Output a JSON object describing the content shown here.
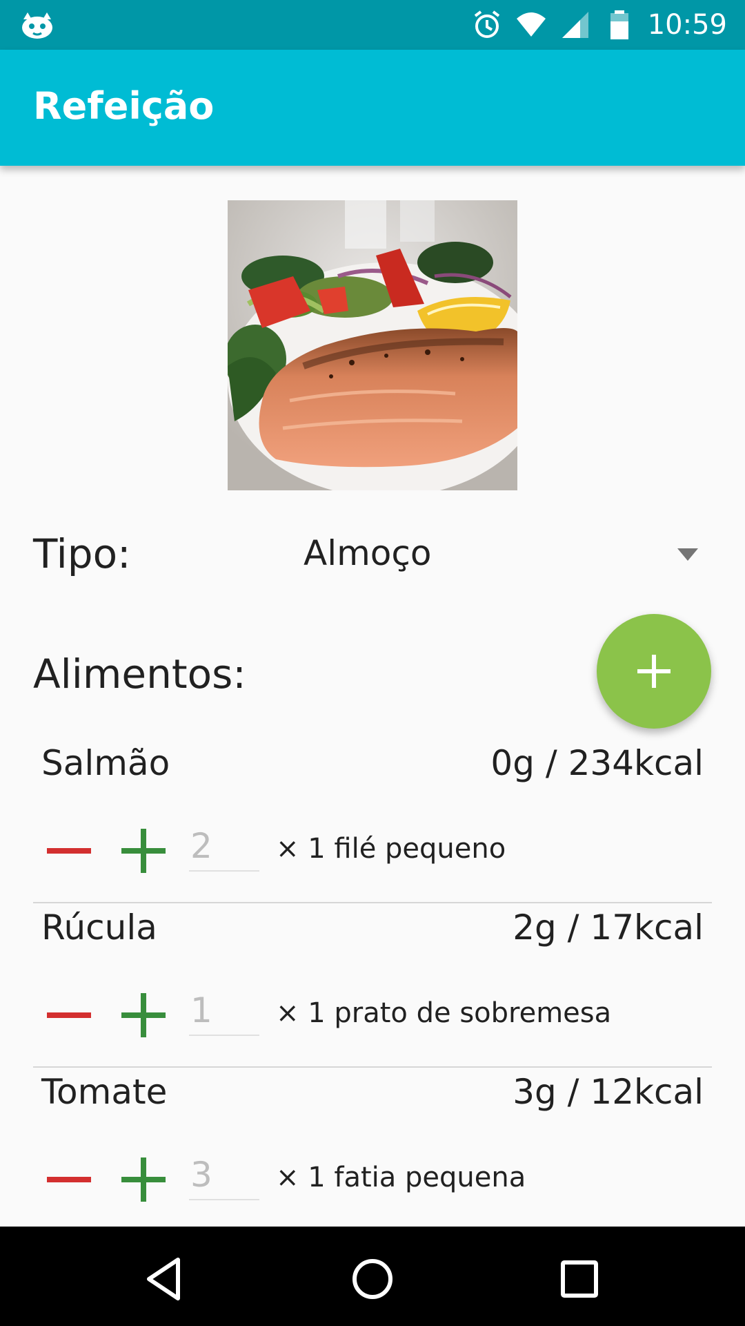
{
  "status_bar": {
    "time": "10:59",
    "background_color": "#0097a7",
    "icons": [
      "app-notification-icon",
      "alarm-icon",
      "wifi-icon",
      "signal-icon",
      "battery-icon"
    ]
  },
  "app_bar": {
    "title": "Refeição",
    "background_color": "#00bcd4"
  },
  "meal": {
    "photo_icon": "meal-photo"
  },
  "type_row": {
    "label": "Tipo:",
    "selected_value": "Almoço"
  },
  "foods": {
    "label": "Alimentos:",
    "add_button_color": "#8bc34a",
    "items": [
      {
        "name": "Salmão",
        "info": "0g / 234kcal",
        "quantity_placeholder": "2",
        "unit": "× 1 filé pequeno"
      },
      {
        "name": "Rúcula",
        "info": "2g / 17kcal",
        "quantity_placeholder": "1",
        "unit": "× 1 prato de sobremesa"
      },
      {
        "name": "Tomate",
        "info": "3g / 12kcal",
        "quantity_placeholder": "3",
        "unit": "× 1 fatia pequena"
      }
    ]
  },
  "colors": {
    "minus": "#d32f2f",
    "plus": "#388e3c"
  },
  "nav_bar": {
    "icons": [
      "back-icon",
      "home-icon",
      "recents-icon"
    ]
  }
}
